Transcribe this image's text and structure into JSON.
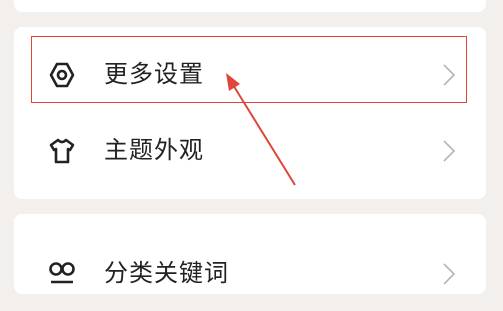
{
  "menu": {
    "items": [
      {
        "label": "更多设置",
        "icon": "gear-icon"
      },
      {
        "label": "主题外观",
        "icon": "shirt-icon"
      },
      {
        "label": "分类关键词",
        "icon": "tags-icon"
      }
    ]
  },
  "colors": {
    "background": "#f2efec",
    "card": "#ffffff",
    "text": "#222222",
    "chevron": "#b5b5b5",
    "annotation": "#e0453a"
  }
}
